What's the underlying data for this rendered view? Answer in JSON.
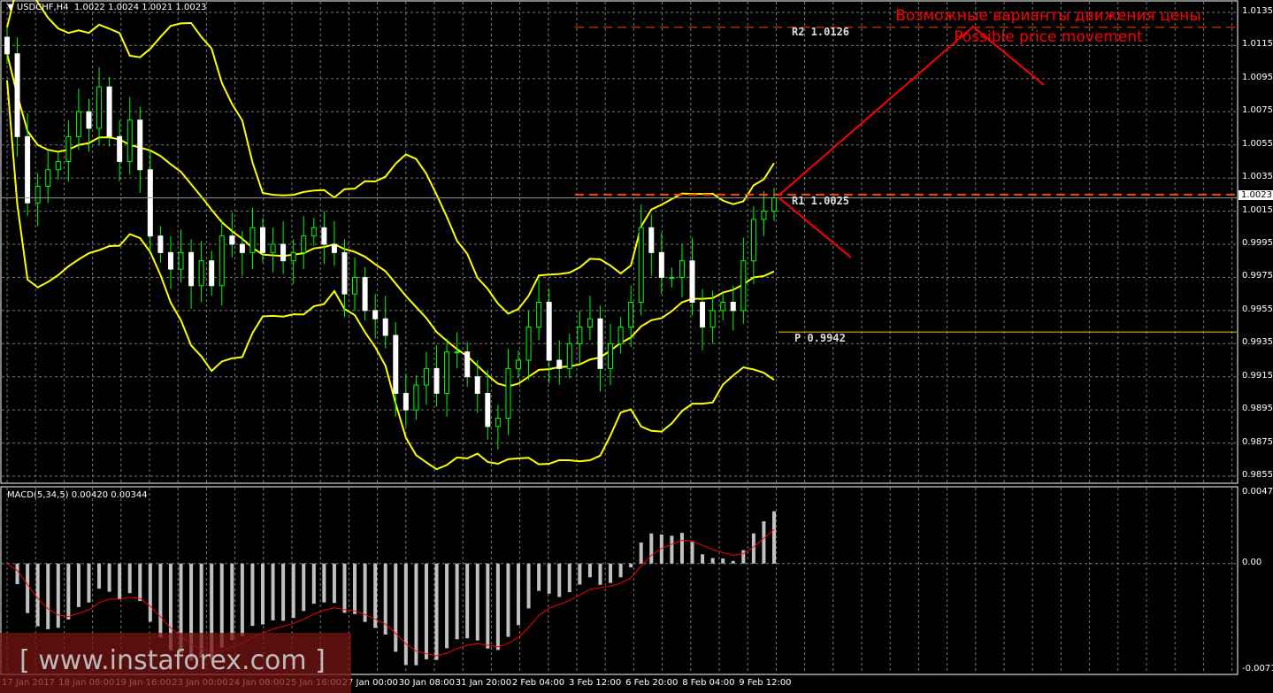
{
  "header": {
    "symbol": "USDCHF,H4",
    "ohlc": "1.0022 1.0024 1.0021 1.0023"
  },
  "macd_header": {
    "label": "MACD(5,34,5) 0.00420 0.00344"
  },
  "annotation": {
    "line1": "Возможные варианты движения цены",
    "line2": "Possible price movement"
  },
  "pivots": {
    "r2": "R2  1.0126",
    "r1": "R1  1.0025",
    "p": "P  0.9942"
  },
  "current_price": "1.0023",
  "watermark": "[ www.instaforex.com ]",
  "colors": {
    "bull": "#00ff00",
    "bear": "#ffffff",
    "bands": "#ffff00",
    "pivot": "#ffc000",
    "resist": "#ff4500",
    "arrow": "#ff0000",
    "macd_signal": "#ff0000",
    "macd_hist": "#c0c0c0"
  },
  "chart_data": {
    "type": "candlestick",
    "title": "USDCHF,H4",
    "price_axis": {
      "ticks": [
        "1.0135",
        "1.0115",
        "1.0095",
        "1.0075",
        "1.0055",
        "1.0035",
        "1.0015",
        "0.9995",
        "0.9975",
        "0.9955",
        "0.9935",
        "0.9915",
        "0.9895",
        "0.9875",
        "0.9855"
      ],
      "range": [
        0.9855,
        1.0135
      ]
    },
    "macd_axis": {
      "ticks": [
        "0.00474",
        "0.00",
        "-0.00715"
      ],
      "range": [
        -0.00715,
        0.00474
      ]
    },
    "time_labels": [
      "17 Jan 2017",
      "18 Jan 08:00",
      "19 Jan 16:00",
      "23 Jan 00:00",
      "24 Jan 08:00",
      "25 Jan 16:00",
      "27 Jan 00:00",
      "30 Jan 08:00",
      "31 Jan 20:00",
      "2 Feb 04:00",
      "3 Feb 12:00",
      "6 Feb 20:00",
      "8 Feb 04:00",
      "9 Feb 12:00"
    ],
    "closes": [
      1.011,
      1.006,
      1.002,
      1.003,
      1.004,
      1.0045,
      1.006,
      1.0075,
      1.0065,
      1.009,
      1.006,
      1.0045,
      1.007,
      1.004,
      1.0,
      0.999,
      0.998,
      0.999,
      0.997,
      0.9985,
      0.997,
      1.0,
      0.9995,
      0.999,
      1.0005,
      0.999,
      0.9995,
      0.9985,
      0.999,
      1.0,
      1.0005,
      0.9995,
      0.999,
      0.9965,
      0.9975,
      0.9955,
      0.995,
      0.994,
      0.9905,
      0.9895,
      0.991,
      0.992,
      0.9905,
      0.993,
      0.993,
      0.9915,
      0.9905,
      0.9885,
      0.989,
      0.992,
      0.9925,
      0.9945,
      0.996,
      0.9925,
      0.992,
      0.9935,
      0.9945,
      0.995,
      0.992,
      0.9935,
      0.9945,
      0.996,
      1.0005,
      0.999,
      0.9975,
      0.9975,
      0.9985,
      0.996,
      0.9945,
      0.9955,
      0.996,
      0.9955,
      0.9985,
      1.001,
      1.0015,
      1.0023
    ],
    "levels": {
      "R2": 1.0126,
      "R1": 1.0025,
      "P": 0.9942,
      "current": 1.0023
    }
  }
}
